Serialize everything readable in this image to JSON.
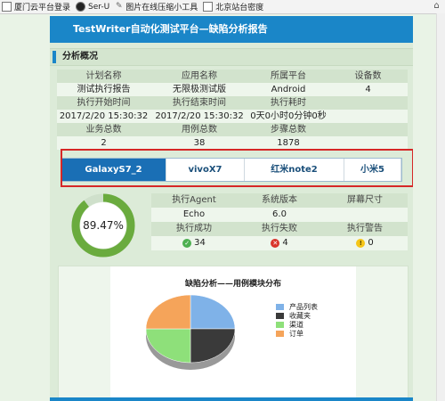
{
  "bookmarks": [
    {
      "label": "厦门云平台登录",
      "icon": "document-icon"
    },
    {
      "label": "Ser-U",
      "icon": "globe-icon"
    },
    {
      "label": "图片在线压缩小工具",
      "icon": "wrench-icon"
    },
    {
      "label": "北京站台密度",
      "icon": "document-icon"
    }
  ],
  "report": {
    "title": "TestWriter自动化测试平台—缺陷分析报告",
    "section_title": "分析概况",
    "summary_rows": [
      {
        "type": "h",
        "cells": [
          "计划名称",
          "应用名称",
          "所属平台",
          "设备数"
        ]
      },
      {
        "type": "v",
        "cells": [
          "测试执行报告",
          "无限极测试版",
          "Android",
          "4"
        ]
      },
      {
        "type": "h",
        "cells": [
          "执行开始时间",
          "执行结束时间",
          "执行耗时",
          ""
        ]
      },
      {
        "type": "v",
        "cells": [
          "2017/2/20 15:30:32",
          "2017/2/20 15:30:32",
          "0天0小时0分钟0秒",
          ""
        ]
      },
      {
        "type": "h",
        "cells": [
          "业务总数",
          "用例总数",
          "步骤总数",
          ""
        ]
      },
      {
        "type": "v",
        "cells": [
          "2",
          "38",
          "1878",
          ""
        ]
      }
    ]
  },
  "tabs": [
    {
      "label": "GalaxyS7_2",
      "active": true
    },
    {
      "label": "vivoX7",
      "active": false
    },
    {
      "label": "红米note2",
      "active": false
    },
    {
      "label": "小米5",
      "active": false
    }
  ],
  "gauge": {
    "value_text": "89.47%",
    "fraction": 0.8947,
    "color": "#6aab3e"
  },
  "device": {
    "headers1": [
      "执行Agent",
      "系统版本",
      "屏幕尺寸"
    ],
    "values1": [
      "Echo",
      "6.0",
      ""
    ],
    "headers2": [
      "执行成功",
      "执行失败",
      "执行警告"
    ],
    "success": "34",
    "fail": "4",
    "warn": "0",
    "colors": {
      "success": "#4caf50",
      "fail": "#d9342b",
      "warn": "#f5c518"
    }
  },
  "chart_data": {
    "type": "pie",
    "title": "缺陷分析——用例模块分布",
    "categories": [
      "产品列表",
      "收藏夹",
      "渠道",
      "订单"
    ],
    "values": [
      25,
      25,
      25,
      25
    ],
    "colors": [
      "#7fb2e8",
      "#3a3a3a",
      "#8ee07a",
      "#f5a45a"
    ],
    "legend_position": "right"
  }
}
